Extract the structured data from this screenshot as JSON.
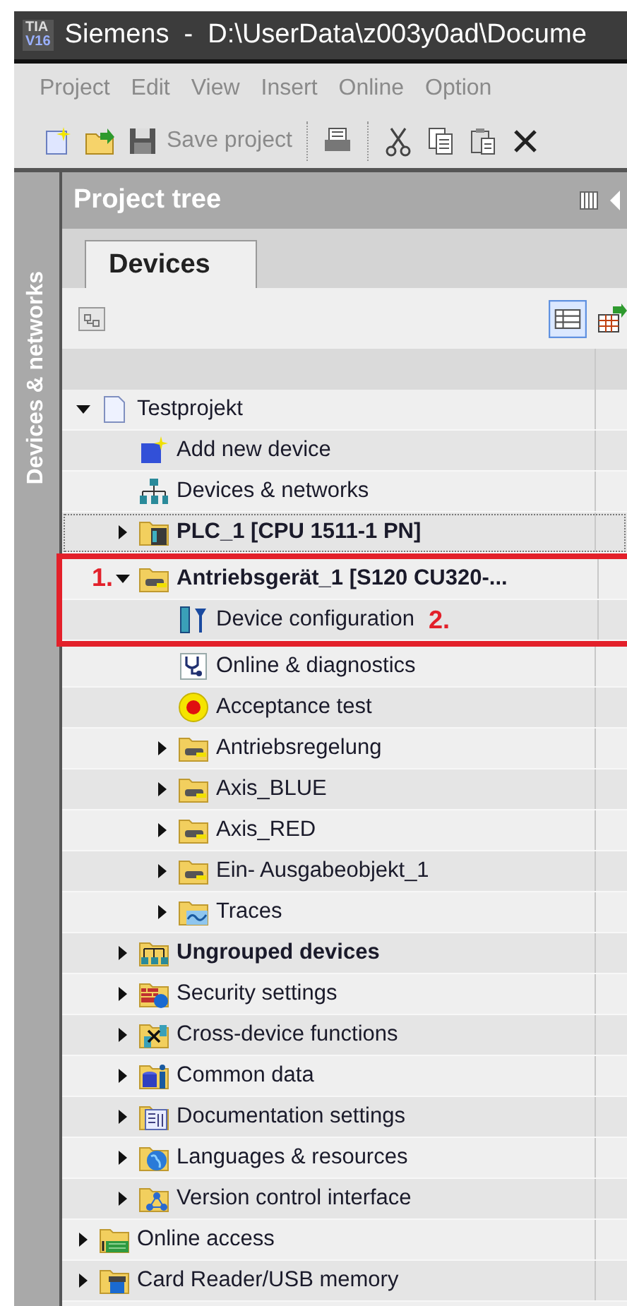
{
  "window": {
    "app_badge_top": "TIA",
    "app_badge_bottom": "V16",
    "title": "Siemens  -  D:\\UserData\\z003y0ad\\Docume"
  },
  "menu": [
    "Project",
    "Edit",
    "View",
    "Insert",
    "Online",
    "Option"
  ],
  "toolbar": [
    {
      "kind": "new"
    },
    {
      "kind": "open"
    },
    {
      "kind": "save",
      "label": "Save project",
      "disabled": true
    },
    {
      "kind": "print"
    },
    {
      "kind": "cut"
    },
    {
      "kind": "copy"
    },
    {
      "kind": "paste"
    },
    {
      "kind": "delete"
    }
  ],
  "side_tab": {
    "label": "Devices & networks"
  },
  "panel": {
    "title": "Project tree"
  },
  "tabs": [
    {
      "label": "Devices",
      "selected": true
    }
  ],
  "tree": [
    {
      "label": "Testprojekt",
      "kind": "project",
      "expanded": true,
      "bold": false,
      "focused": false,
      "callout": false,
      "children": [
        {
          "label": "Add new device",
          "kind": "add-device",
          "bold": false,
          "focused": false,
          "callout": false
        },
        {
          "label": "Devices & networks",
          "kind": "network",
          "bold": false,
          "focused": false,
          "callout": false
        },
        {
          "label": "PLC_1 [CPU 1511-1 PN]",
          "kind": "plc",
          "expanded": false,
          "bold": true,
          "focused": true,
          "callout": false
        },
        {
          "label": "Antriebsgerät_1 [S120 CU320-...",
          "kind": "drive",
          "expanded": true,
          "bold": true,
          "focused": false,
          "callout": true,
          "marker_before": "1.",
          "children": [
            {
              "label": "Device configuration",
              "kind": "config",
              "bold": false,
              "focused": false,
              "callout": true,
              "marker_after": "2."
            },
            {
              "label": "Online & diagnostics",
              "kind": "diagnostics",
              "bold": false,
              "focused": false,
              "callout": false
            },
            {
              "label": "Acceptance test",
              "kind": "acceptance",
              "bold": false,
              "focused": false,
              "callout": false
            },
            {
              "label": "Antriebsregelung",
              "kind": "drive",
              "expanded": false,
              "bold": false,
              "focused": false,
              "callout": false
            },
            {
              "label": "Axis_BLUE",
              "kind": "drive",
              "expanded": false,
              "bold": false,
              "focused": false,
              "callout": false
            },
            {
              "label": "Axis_RED",
              "kind": "drive",
              "expanded": false,
              "bold": false,
              "focused": false,
              "callout": false
            },
            {
              "label": "Ein- Ausgabeobjekt_1",
              "kind": "drive",
              "expanded": false,
              "bold": false,
              "focused": false,
              "callout": false
            },
            {
              "label": "Traces",
              "kind": "traces",
              "expanded": false,
              "bold": false,
              "focused": false,
              "callout": false
            }
          ]
        },
        {
          "label": "Ungrouped devices",
          "kind": "ungrouped",
          "expanded": false,
          "bold": true,
          "focused": false,
          "callout": false
        },
        {
          "label": "Security settings",
          "kind": "security",
          "expanded": false,
          "bold": false,
          "focused": false,
          "callout": false
        },
        {
          "label": "Cross-device functions",
          "kind": "cross-device",
          "expanded": false,
          "bold": false,
          "focused": false,
          "callout": false
        },
        {
          "label": "Common data",
          "kind": "common-data",
          "expanded": false,
          "bold": false,
          "focused": false,
          "callout": false
        },
        {
          "label": "Documentation settings",
          "kind": "documentation",
          "expanded": false,
          "bold": false,
          "focused": false,
          "callout": false
        },
        {
          "label": "Languages & resources",
          "kind": "languages",
          "expanded": false,
          "bold": false,
          "focused": false,
          "callout": false
        },
        {
          "label": "Version control interface",
          "kind": "version-control",
          "expanded": false,
          "bold": false,
          "focused": false,
          "callout": false
        }
      ]
    },
    {
      "label": "Online access",
      "kind": "online-access",
      "expanded": false,
      "bold": false,
      "focused": false,
      "callout": false
    },
    {
      "label": "Card Reader/USB memory",
      "kind": "card-reader",
      "expanded": false,
      "bold": false,
      "focused": false,
      "callout": false
    }
  ]
}
